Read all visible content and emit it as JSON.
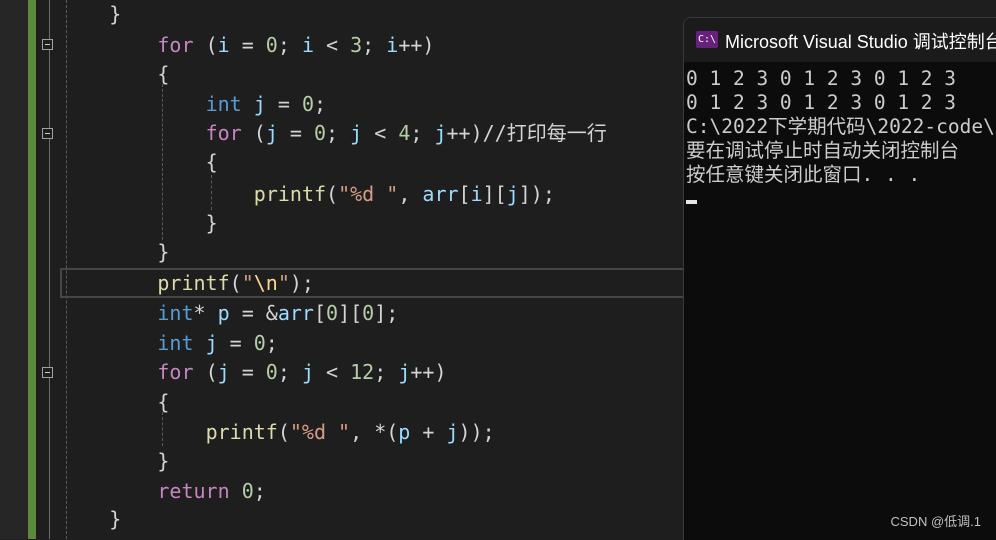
{
  "editor": {
    "lines": [
      "    }",
      "        for (i = 0; i < 3; i++)",
      "        {",
      "            int j = 0;",
      "            for (j = 0; j < 4; j++)//打印每一行",
      "            {",
      "                printf(\"%d \", arr[i][j]);",
      "            }",
      "        }",
      "        printf(\"\\n\");",
      "        int* p = &arr[0][0];",
      "        int j = 0;",
      "        for (j = 0; j < 12; j++)",
      "        {",
      "            printf(\"%d \", *(p + j));",
      "        }",
      "        return 0;",
      "    }"
    ]
  },
  "console": {
    "icon": "C:\\",
    "title": "Microsoft Visual Studio 调试控制台",
    "output": [
      "0 1 2 3 0 1 2 3 0 1 2 3",
      "0 1 2 3 0 1 2 3 0 1 2 3",
      "C:\\2022下学期代码\\2022-code\\",
      "要在调试停止时自动关闭控制台",
      "按任意键关闭此窗口. . ."
    ]
  },
  "watermark": "CSDN @低调.1"
}
